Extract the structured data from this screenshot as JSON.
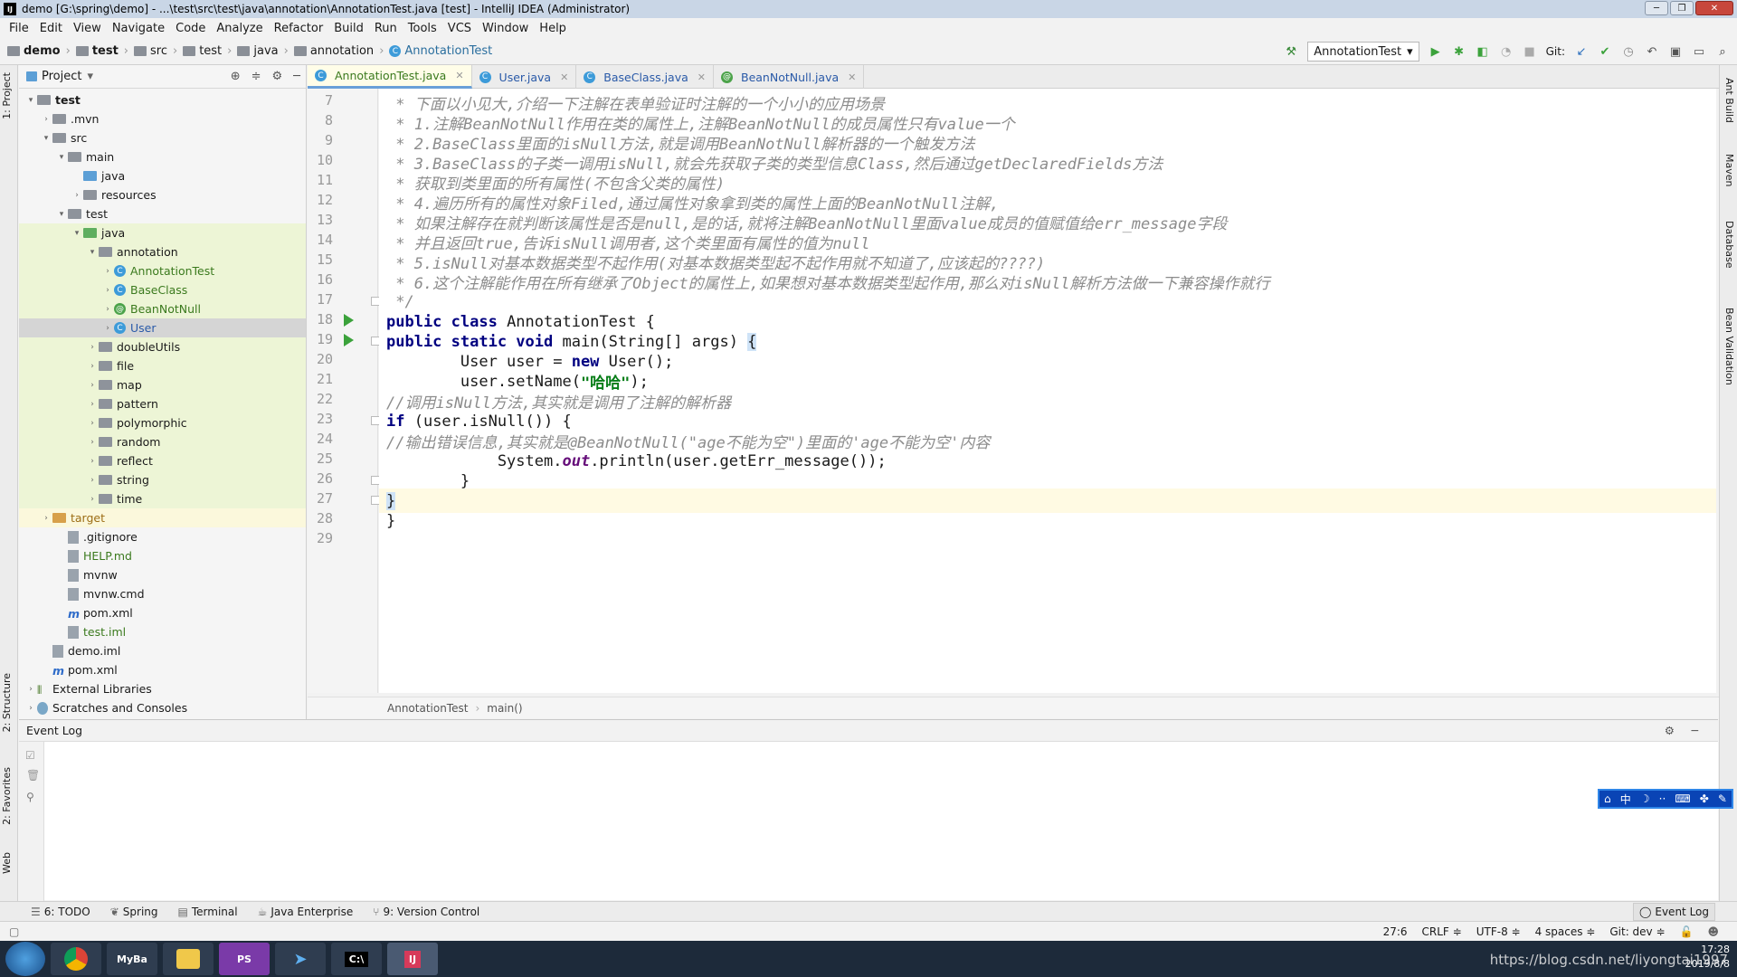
{
  "window": {
    "title": "demo [G:\\spring\\demo] - ...\\test\\src\\test\\java\\annotation\\AnnotationTest.java [test] - IntelliJ IDEA (Administrator)"
  },
  "menu": [
    "File",
    "Edit",
    "View",
    "Navigate",
    "Code",
    "Analyze",
    "Refactor",
    "Build",
    "Run",
    "Tools",
    "VCS",
    "Window",
    "Help"
  ],
  "breadcrumb": [
    "demo",
    "test",
    "src",
    "test",
    "java",
    "annotation",
    "AnnotationTest"
  ],
  "toolbar": {
    "run_config": "AnnotationTest",
    "git_label": "Git:"
  },
  "project_panel": {
    "title": "Project",
    "tree": [
      {
        "label": "test",
        "depth": 0,
        "expanded": true,
        "type": "module",
        "bold": true
      },
      {
        "label": ".mvn",
        "depth": 1,
        "expanded": false,
        "type": "folder"
      },
      {
        "label": "src",
        "depth": 1,
        "expanded": true,
        "type": "folder"
      },
      {
        "label": "main",
        "depth": 2,
        "expanded": true,
        "type": "folder"
      },
      {
        "label": "java",
        "depth": 3,
        "expanded": null,
        "type": "srcfolder"
      },
      {
        "label": "resources",
        "depth": 3,
        "expanded": false,
        "type": "folder"
      },
      {
        "label": "test",
        "depth": 2,
        "expanded": true,
        "type": "folder"
      },
      {
        "label": "java",
        "depth": 3,
        "expanded": true,
        "type": "testfolder",
        "hl": true
      },
      {
        "label": "annotation",
        "depth": 4,
        "expanded": true,
        "type": "package",
        "hl": true
      },
      {
        "label": "AnnotationTest",
        "depth": 5,
        "expanded": false,
        "type": "class",
        "hl": true
      },
      {
        "label": "BaseClass",
        "depth": 5,
        "expanded": false,
        "type": "class",
        "hl": true
      },
      {
        "label": "BeanNotNull",
        "depth": 5,
        "expanded": false,
        "type": "annotation",
        "hl": true
      },
      {
        "label": "User",
        "depth": 5,
        "expanded": false,
        "type": "class",
        "sel": true
      },
      {
        "label": "doubleUtils",
        "depth": 4,
        "expanded": false,
        "type": "package",
        "hl": true
      },
      {
        "label": "file",
        "depth": 4,
        "expanded": false,
        "type": "package",
        "hl": true
      },
      {
        "label": "map",
        "depth": 4,
        "expanded": false,
        "type": "package",
        "hl": true
      },
      {
        "label": "pattern",
        "depth": 4,
        "expanded": false,
        "type": "package",
        "hl": true
      },
      {
        "label": "polymorphic",
        "depth": 4,
        "expanded": false,
        "type": "package",
        "hl": true
      },
      {
        "label": "random",
        "depth": 4,
        "expanded": false,
        "type": "package",
        "hl": true
      },
      {
        "label": "reflect",
        "depth": 4,
        "expanded": false,
        "type": "package",
        "hl": true
      },
      {
        "label": "string",
        "depth": 4,
        "expanded": false,
        "type": "package",
        "hl": true
      },
      {
        "label": "time",
        "depth": 4,
        "expanded": false,
        "type": "package",
        "hl": true
      },
      {
        "label": "target",
        "depth": 1,
        "expanded": false,
        "type": "excluded",
        "hl2": true
      },
      {
        "label": ".gitignore",
        "depth": 2,
        "expanded": null,
        "type": "file"
      },
      {
        "label": "HELP.md",
        "depth": 2,
        "expanded": null,
        "type": "md"
      },
      {
        "label": "mvnw",
        "depth": 2,
        "expanded": null,
        "type": "file"
      },
      {
        "label": "mvnw.cmd",
        "depth": 2,
        "expanded": null,
        "type": "file"
      },
      {
        "label": "pom.xml",
        "depth": 2,
        "expanded": null,
        "type": "maven"
      },
      {
        "label": "test.iml",
        "depth": 2,
        "expanded": null,
        "type": "iml"
      },
      {
        "label": "demo.iml",
        "depth": 1,
        "expanded": null,
        "type": "file"
      },
      {
        "label": "pom.xml",
        "depth": 1,
        "expanded": null,
        "type": "maven"
      },
      {
        "label": "External Libraries",
        "depth": 0,
        "expanded": false,
        "type": "lib"
      },
      {
        "label": "Scratches and Consoles",
        "depth": 0,
        "expanded": false,
        "type": "scratch"
      }
    ]
  },
  "editor_tabs": [
    {
      "label": "AnnotationTest.java",
      "active": true,
      "icon": "class"
    },
    {
      "label": "User.java",
      "active": false,
      "icon": "class"
    },
    {
      "label": "BaseClass.java",
      "active": false,
      "icon": "class"
    },
    {
      "label": "BeanNotNull.java",
      "active": false,
      "icon": "annotation"
    }
  ],
  "code_lines": [
    {
      "n": "7",
      "html": "<span class=\"cmt\"> * 下面以小见大,介绍一下注解在表单验证时注解的一个小小的应用场景</span>"
    },
    {
      "n": "8",
      "html": "<span class=\"cmt\"> * 1.注解BeanNotNull作用在类的属性上,注解BeanNotNull的成员属性只有value一个</span>"
    },
    {
      "n": "9",
      "html": "<span class=\"cmt\"> * 2.BaseClass里面的isNull方法,就是调用BeanNotNull解析器的一个触发方法</span>"
    },
    {
      "n": "10",
      "html": "<span class=\"cmt\"> * 3.BaseClass的子类一调用isNull,就会先获取子类的类型信息Class,然后通过getDeclaredFields方法</span>"
    },
    {
      "n": "11",
      "html": "<span class=\"cmt\"> * 获取到类里面的所有属性(不包含父类的属性)</span>"
    },
    {
      "n": "12",
      "html": "<span class=\"cmt\"> * 4.遍历所有的属性对象Filed,通过属性对象拿到类的属性上面的BeanNotNull注解,</span>"
    },
    {
      "n": "13",
      "html": "<span class=\"cmt\"> * 如果注解存在就判断该属性是否是null,是的话,就将注解BeanNotNull里面value成员的值赋值给err_message字段</span>"
    },
    {
      "n": "14",
      "html": "<span class=\"cmt\"> * 并且返回true,告诉isNull调用者,这个类里面有属性的值为null</span>"
    },
    {
      "n": "15",
      "html": "<span class=\"cmt\"> * 5.isNull对基本数据类型不起作用(对基本数据类型起不起作用就不知道了,应该起的????)</span>"
    },
    {
      "n": "16",
      "html": "<span class=\"cmt\"> * 6.这个注解能作用在所有继承了Object的属性上,如果想对基本数据类型起作用,那么对isNull解析方法做一下兼容操作就行</span>"
    },
    {
      "n": "17",
      "html": "<span class=\"cmt\"> */</span>"
    },
    {
      "n": "18",
      "html": "<span class=\"kw\">public class</span> AnnotationTest {"
    },
    {
      "n": "19",
      "html": "    <span class=\"kw\">public static void</span> main(String[] args) <span style=\"background:#cfe3f7\">{</span>"
    },
    {
      "n": "20",
      "html": "        User user = <span class=\"kw\">new</span> User();"
    },
    {
      "n": "21",
      "html": "        user.setName(<span class=\"str\">\"哈哈\"</span>);"
    },
    {
      "n": "22",
      "html": "        <span class=\"cmt\">//调用isNull方法,其实就是调用了注解的解析器</span>"
    },
    {
      "n": "23",
      "html": "        <span class=\"kw\">if</span> (user.isNull()) {"
    },
    {
      "n": "24",
      "html": "            <span class=\"cmt\">//输出错误信息,其实就是@BeanNotNull(\"age不能为空\")里面的'age不能为空'内容</span>"
    },
    {
      "n": "25",
      "html": "            System.<span class=\"fld\">out</span>.println(user.getErr_message());"
    },
    {
      "n": "26",
      "html": "        }"
    },
    {
      "n": "27",
      "html": "    <span style=\"background:#cfe3f7\">}</span>"
    },
    {
      "n": "28",
      "html": "}"
    },
    {
      "n": "29",
      "html": ""
    }
  ],
  "editor_breadcrumb": [
    "AnnotationTest",
    "main()"
  ],
  "event_log": {
    "title": "Event Log"
  },
  "side_tabs_left": [
    "1: Project",
    "2: Structure",
    "2: Favorites",
    "Web"
  ],
  "side_tabs_right": [
    "Ant Build",
    "Maven",
    "Database",
    "Bean Validation"
  ],
  "bottom_tabs": [
    {
      "label": "6: TODO",
      "icon": "todo-icon"
    },
    {
      "label": "Spring",
      "icon": "spring-icon"
    },
    {
      "label": "Terminal",
      "icon": "terminal-icon"
    },
    {
      "label": "Java Enterprise",
      "icon": "java-ee-icon"
    },
    {
      "label": "9: Version Control",
      "icon": "vcs-icon"
    }
  ],
  "bottom_right_tab": "Event Log",
  "status_bar": {
    "position": "27:6",
    "line_sep": "CRLF ≑",
    "encoding": "UTF-8 ≑",
    "indent": "4 spaces ≑",
    "git_branch": "Git: dev ≑"
  },
  "taskbar": {
    "apps": [
      "chrome",
      "MyBatis",
      "explorer",
      "PS",
      "feather",
      "cmd",
      "IJ"
    ],
    "time": "17:28",
    "date": "2019/8/8",
    "watermark": "https://blog.csdn.net/liyongtai1997"
  },
  "ime": "中",
  "colors": {
    "accent": "#3d9bd9",
    "run_green": "#3ba23b",
    "caret_line": "#fffae3",
    "taskbar": "#1d2a3a"
  }
}
